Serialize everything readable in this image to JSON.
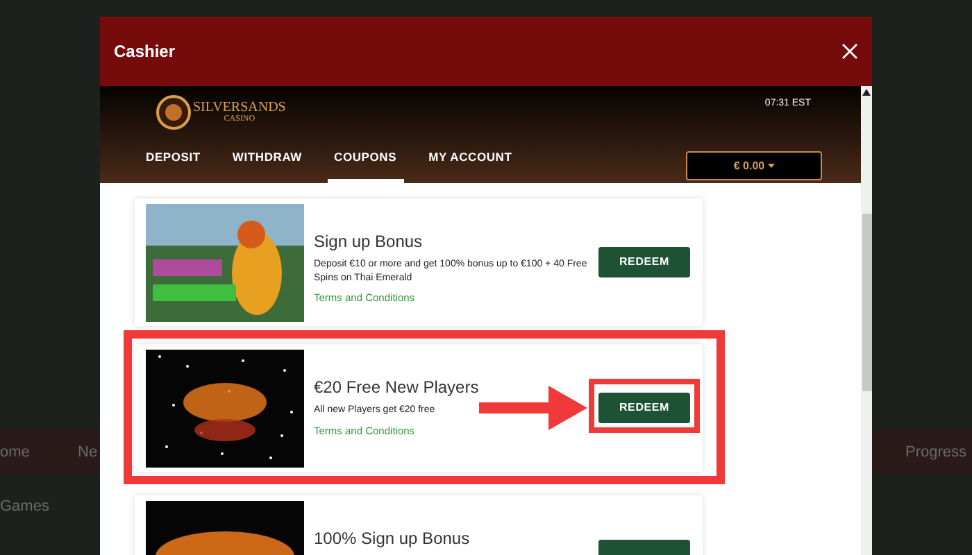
{
  "background": {
    "texts": [
      {
        "kind": "pill",
        "text": "ome"
      },
      {
        "kind": "pill",
        "text": "Ne"
      },
      {
        "kind": "link",
        "text": "Games"
      },
      {
        "kind": "pill-right",
        "text": "Progress"
      }
    ]
  },
  "modal": {
    "title": "Cashier"
  },
  "brand": {
    "name": "SILVERSANDS",
    "subtitle": "CASINO"
  },
  "clock": "07:31 EST",
  "tabs": [
    {
      "label": "DEPOSIT",
      "selected": false
    },
    {
      "label": "WITHDRAW",
      "selected": false
    },
    {
      "label": "COUPONS",
      "selected": true
    },
    {
      "label": "MY ACCOUNT",
      "selected": false
    }
  ],
  "balance": "€ 0.00",
  "coupons": [
    {
      "kind": "parrot",
      "title": "Sign up Bonus",
      "description": "Deposit €10 or more and get 100% bonus up to €100 + 40 Free Spins on Thai Emerald",
      "terms": "Terms and Conditions",
      "button": "REDEEM",
      "highlighted": false
    },
    {
      "kind": "stars",
      "title": "€20 Free New Players",
      "description": "All new Players get €20 free",
      "terms": "Terms and Conditions",
      "button": "REDEEM",
      "highlighted": true
    },
    {
      "kind": "glow",
      "title": "100% Sign up Bonus",
      "highlighted": false
    }
  ]
}
